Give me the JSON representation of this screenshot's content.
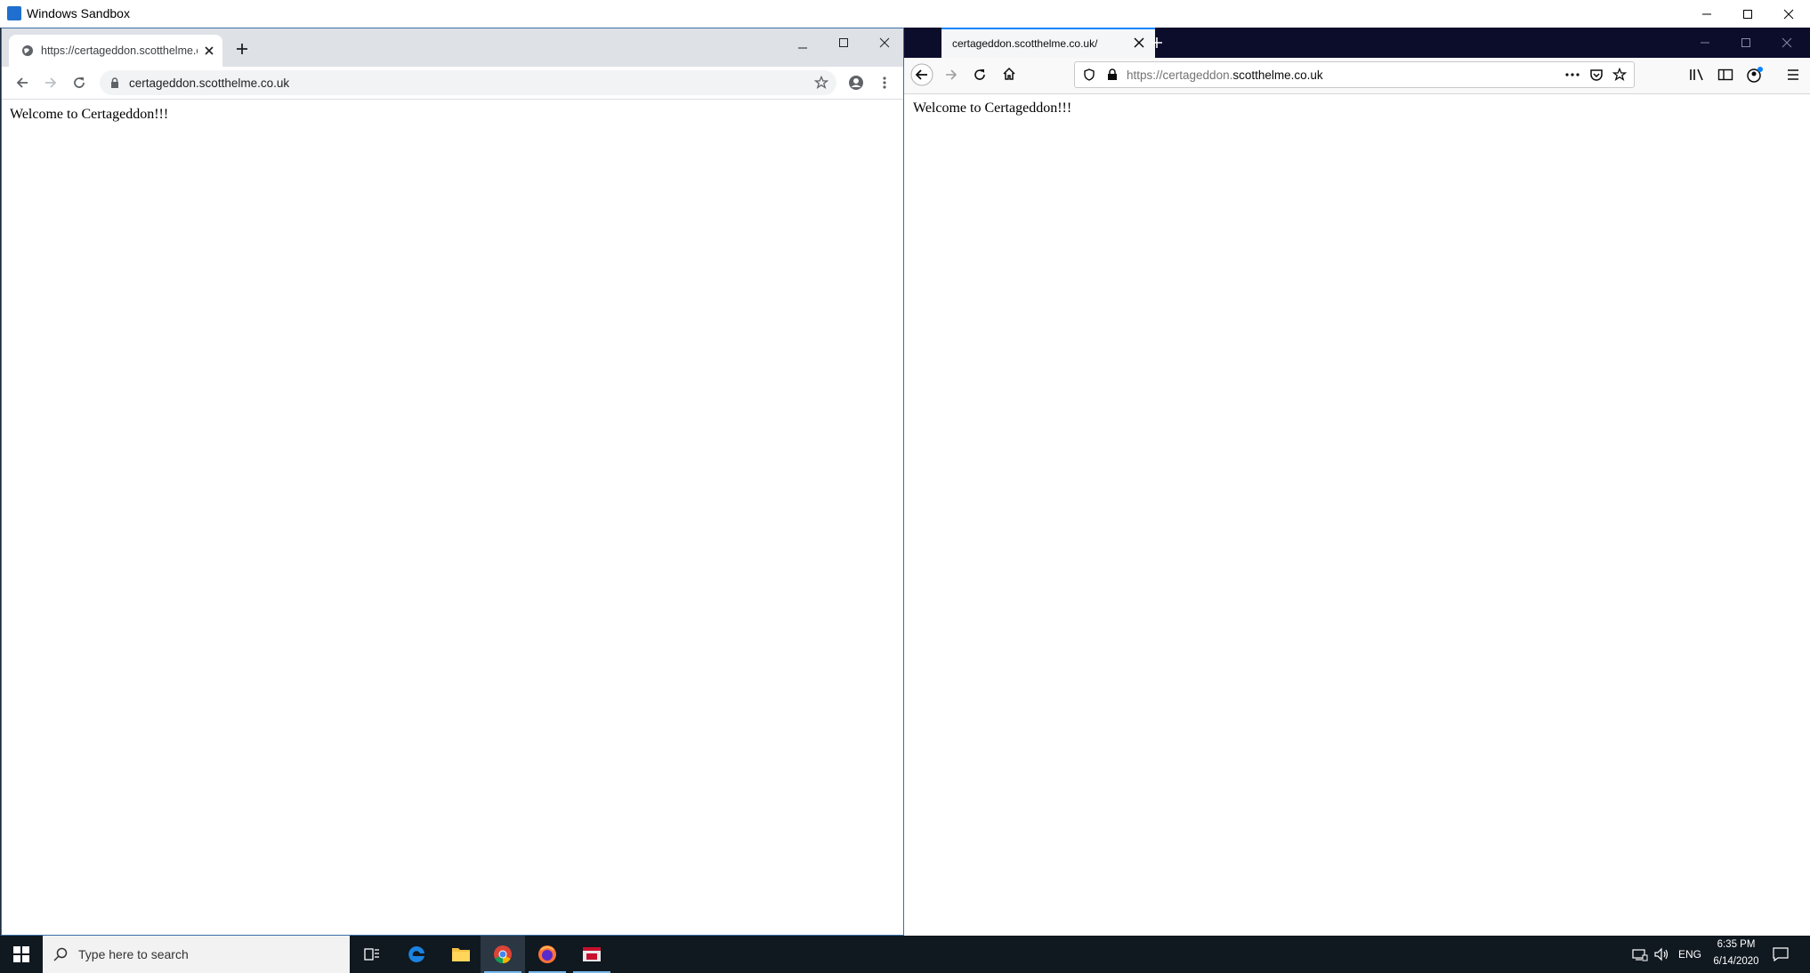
{
  "sandbox": {
    "title": "Windows Sandbox",
    "controls": [
      "minimize-icon",
      "maximize-icon",
      "close-icon"
    ]
  },
  "chrome": {
    "tab_title": "https://certageddon.scotthelme.co.uk/",
    "address": "certageddon.scotthelme.co.uk",
    "page_text": "Welcome to Certageddon!!!"
  },
  "firefox": {
    "tab_title": "certageddon.scotthelme.co.uk/",
    "url_prefix": "https://certageddon.",
    "url_domain": "scotthelme.co.uk",
    "page_text": "Welcome to Certageddon!!!"
  },
  "taskbar": {
    "search_placeholder": "Type here to search",
    "apps": [
      "task-view-icon",
      "edge-icon",
      "file-explorer-icon",
      "chrome-icon",
      "firefox-icon",
      "app-icon"
    ],
    "language": "ENG",
    "time": "6:35 PM",
    "date": "6/14/2020"
  },
  "colors": {
    "taskbar": "#101820",
    "chrome_tabstrip": "#dee1e6",
    "firefox_tabstrip": "#0c0c2b",
    "firefox_accent": "#0a84ff"
  }
}
